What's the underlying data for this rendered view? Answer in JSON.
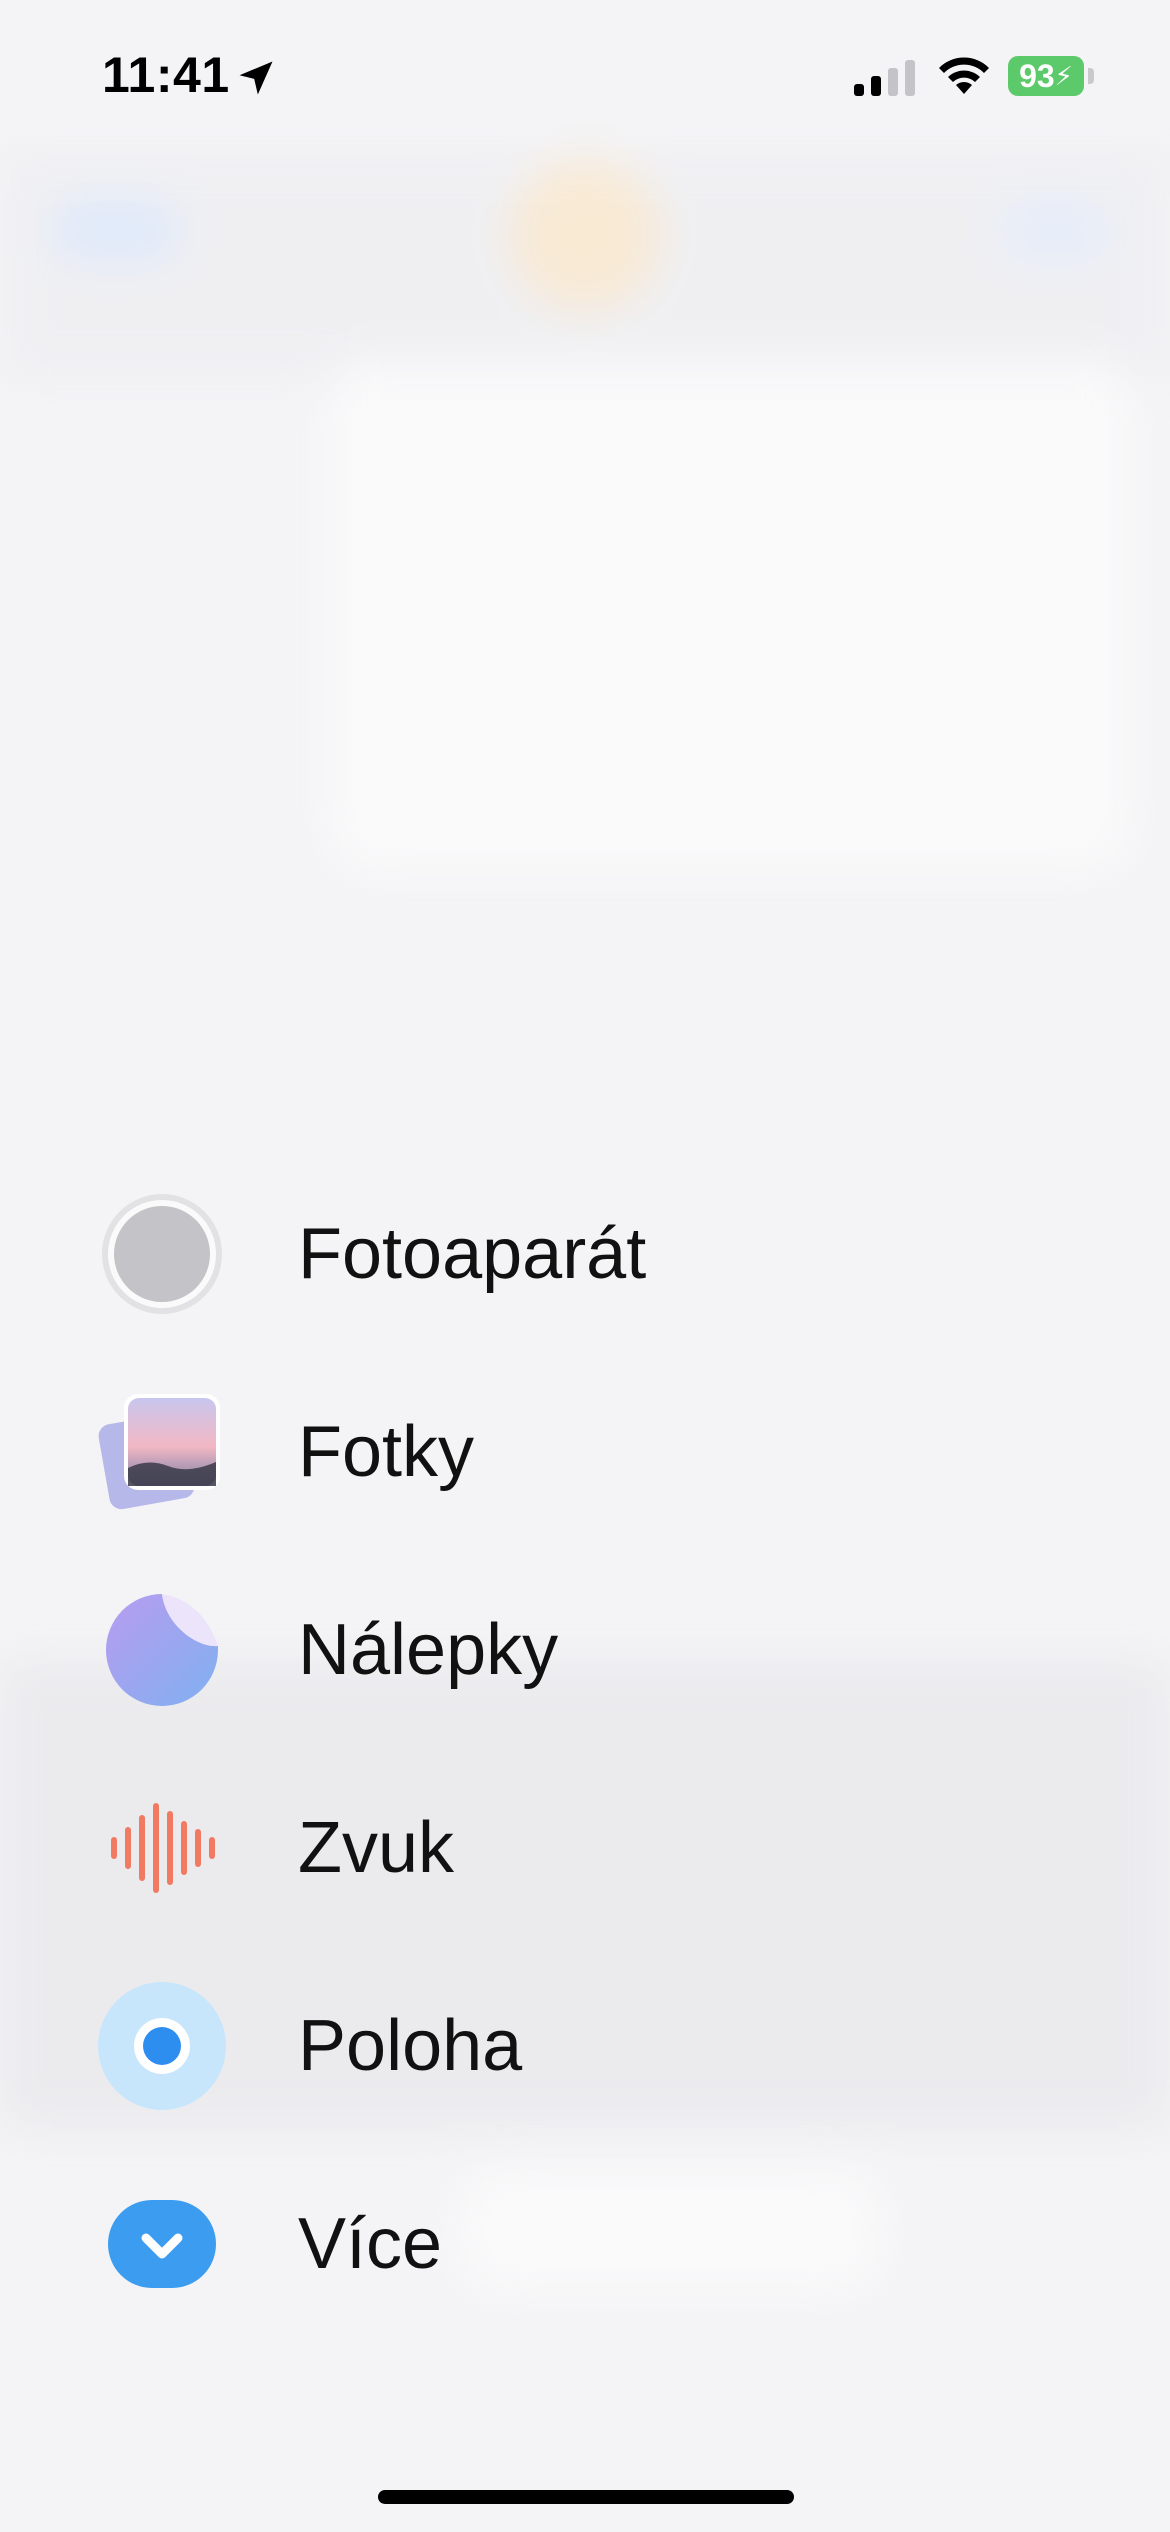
{
  "status_bar": {
    "time": "11:41",
    "battery": "93"
  },
  "menu": {
    "items": [
      {
        "label": "Fotoaparát",
        "icon": "camera-icon"
      },
      {
        "label": "Fotky",
        "icon": "photos-icon"
      },
      {
        "label": "Nálepky",
        "icon": "stickers-icon"
      },
      {
        "label": "Zvuk",
        "icon": "audio-waveform-icon"
      },
      {
        "label": "Poloha",
        "icon": "location-icon"
      },
      {
        "label": "Více",
        "icon": "chevron-down-icon"
      }
    ]
  },
  "colors": {
    "background": "#f4f4f6",
    "battery_green": "#5cc96a",
    "audio_red": "#f07a62",
    "location_blue": "#2e8ef0",
    "more_blue": "#3c9cf0"
  }
}
